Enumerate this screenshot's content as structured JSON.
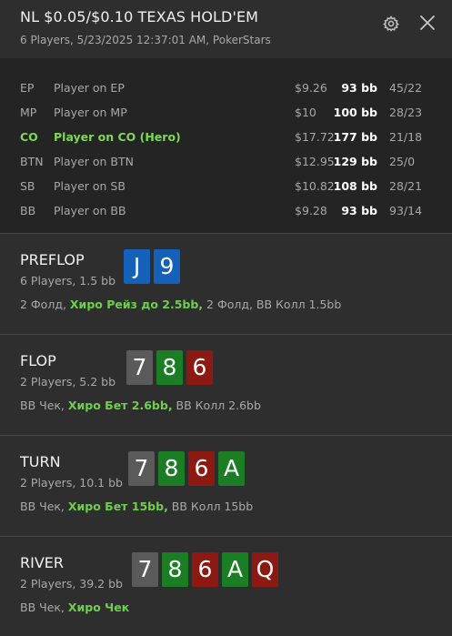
{
  "header": {
    "title": "NL $0.05/$0.10 TEXAS HOLD'EM",
    "subtitle": "6 Players, 5/23/2025 12:37:01 AM, PokerStars",
    "settings_icon": "gear-icon",
    "close_icon": "close-icon"
  },
  "players": [
    {
      "pos": "EP",
      "name": "Player on EP",
      "stack": "$9.26",
      "bb": "93 bb",
      "stat": "45/22",
      "hero": false
    },
    {
      "pos": "MP",
      "name": "Player on MP",
      "stack": "$10",
      "bb": "100 bb",
      "stat": "28/23",
      "hero": false
    },
    {
      "pos": "CO",
      "name": "Player on CO (Hero)",
      "stack": "$17.72",
      "bb": "177 bb",
      "stat": "21/18",
      "hero": true
    },
    {
      "pos": "BTN",
      "name": "Player on BTN",
      "stack": "$12.95",
      "bb": "129 bb",
      "stat": "25/0",
      "hero": false
    },
    {
      "pos": "SB",
      "name": "Player on SB",
      "stack": "$10.82",
      "bb": "108 bb",
      "stat": "28/21",
      "hero": false
    },
    {
      "pos": "BB",
      "name": "Player on BB",
      "stack": "$9.28",
      "bb": "93 bb",
      "stat": "93/14",
      "hero": false
    }
  ],
  "colors": {
    "hero_green": "#7ed957",
    "card_blue": "#1560b8",
    "card_grey": "#5a5a5a",
    "card_green": "#1b7e25",
    "card_red": "#8c1a13"
  },
  "streets": {
    "preflop": {
      "name": "PREFLOP",
      "info": "6 Players, 1.5 bb",
      "cards": [
        {
          "rank": "J",
          "color": "blue"
        },
        {
          "rank": "9",
          "color": "blue"
        }
      ],
      "act_before": "2 Фолд, ",
      "act_hero": "Хиро Рейз до 2.5bb,",
      "act_after": " 2 Фолд, BB Колл 1.5bb"
    },
    "flop": {
      "name": "FLOP",
      "info": "2 Players, 5.2 bb",
      "cards": [
        {
          "rank": "7",
          "color": "grey"
        },
        {
          "rank": "8",
          "color": "green"
        },
        {
          "rank": "6",
          "color": "red"
        }
      ],
      "act_before": "BB Чек, ",
      "act_hero": "Хиро Бет 2.6bb,",
      "act_after": " BB Колл 2.6bb"
    },
    "turn": {
      "name": "TURN",
      "info": "2 Players, 10.1 bb",
      "cards": [
        {
          "rank": "7",
          "color": "grey"
        },
        {
          "rank": "8",
          "color": "green"
        },
        {
          "rank": "6",
          "color": "red"
        },
        {
          "rank": "A",
          "color": "green"
        }
      ],
      "act_before": "BB Чек, ",
      "act_hero": "Хиро Бет 15bb,",
      "act_after": " BB Колл 15bb"
    },
    "river": {
      "name": "RIVER",
      "info": "2 Players, 39.2 bb",
      "cards": [
        {
          "rank": "7",
          "color": "grey"
        },
        {
          "rank": "8",
          "color": "green"
        },
        {
          "rank": "6",
          "color": "red"
        },
        {
          "rank": "A",
          "color": "green"
        },
        {
          "rank": "Q",
          "color": "red"
        }
      ],
      "act_before": "BB Чек, ",
      "act_hero": "Хиро Чек",
      "act_after": ""
    }
  }
}
